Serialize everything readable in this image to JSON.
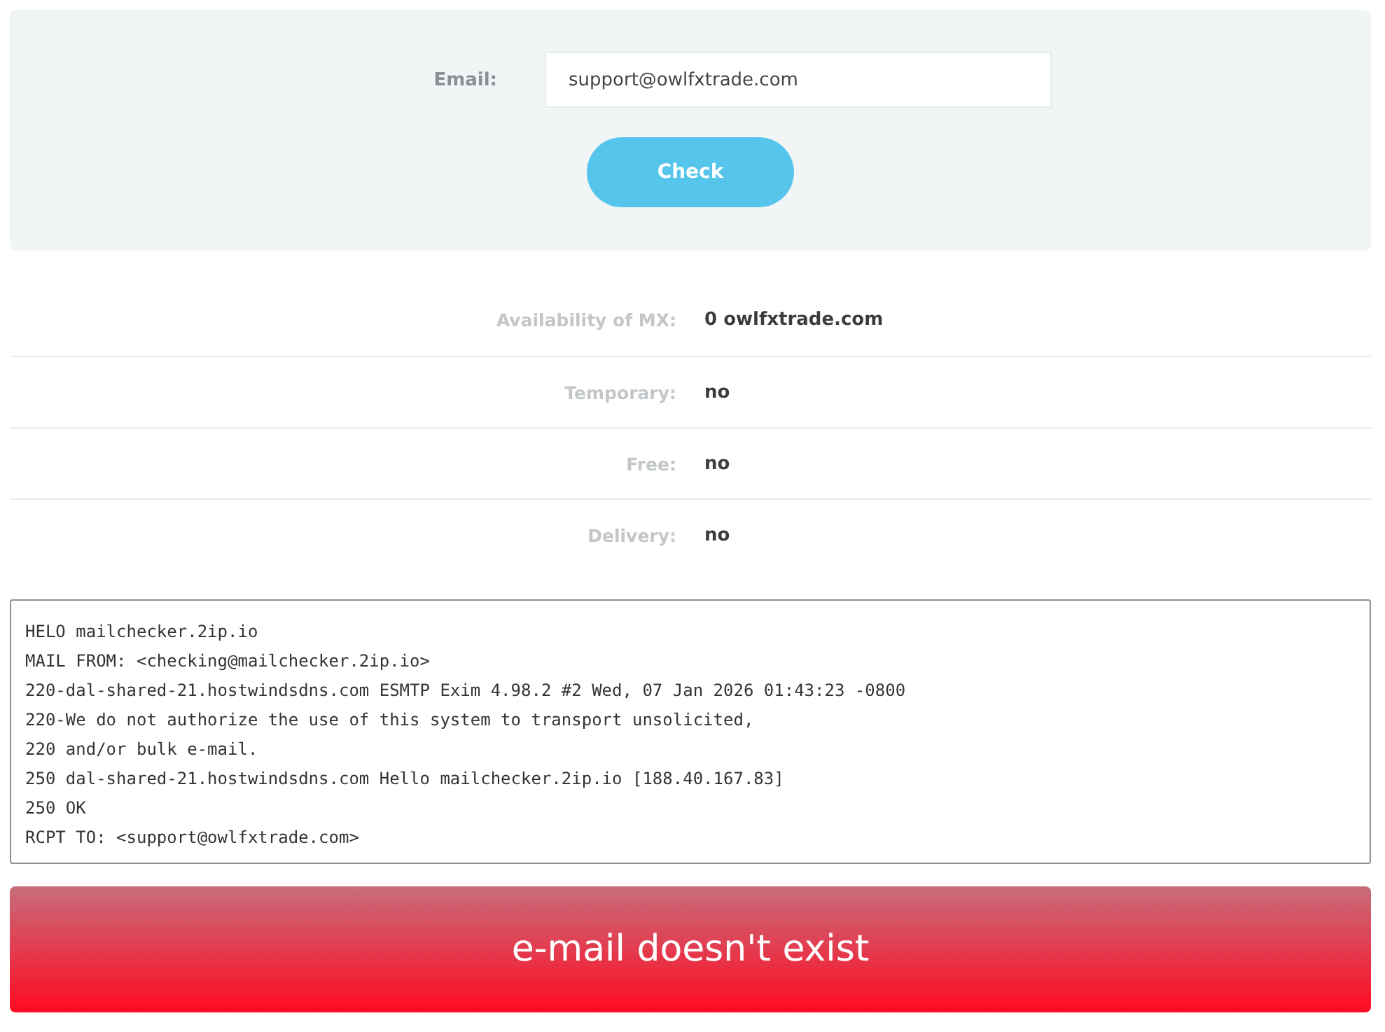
{
  "form": {
    "label": "Email:",
    "value": "support@owlfxtrade.com",
    "button": "Check"
  },
  "details": [
    {
      "label": "Availability of MX:",
      "value": "**0** owlfxtrade.com"
    },
    {
      "label": "Temporary:",
      "value": "no"
    },
    {
      "label": "Free:",
      "value": "no"
    },
    {
      "label": "Delivery:",
      "value": "no"
    }
  ],
  "log": [
    "HELO mailchecker.2ip.io",
    "MAIL FROM: <checking@mailchecker.2ip.io>",
    "220-dal-shared-21.hostwindsdns.com ESMTP Exim 4.98.2 #2 Wed, 07 Jan 2026 01:43:23 -0800",
    "220-We do not authorize the use of this system to transport unsolicited,",
    "220 and/or bulk e-mail.",
    "250 dal-shared-21.hostwindsdns.com Hello mailchecker.2ip.io [188.40.167.83]",
    "250 OK",
    "RCPT TO: <support@owlfxtrade.com>"
  ],
  "result": {
    "kind": "error",
    "text": "e-mail doesn't exist"
  }
}
